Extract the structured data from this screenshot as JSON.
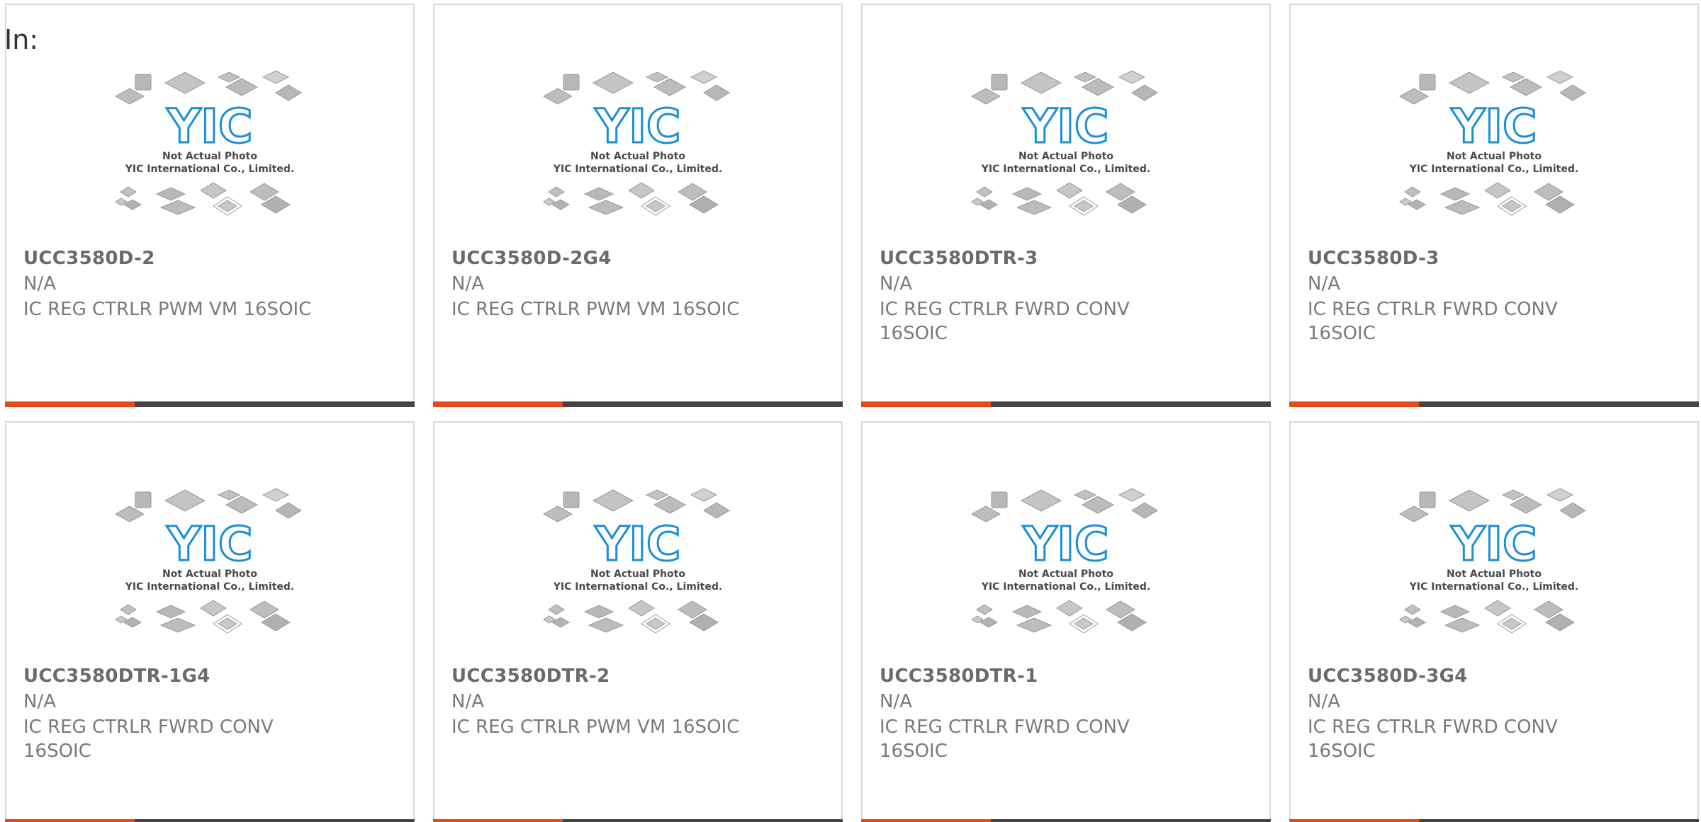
{
  "header": {
    "label": "In:"
  },
  "colors": {
    "accent": "#e64a19",
    "bar": "#444444",
    "logo": "#1b8ed6",
    "text": "#7a7a7a"
  },
  "placeholder": {
    "line1": "Not Actual Photo",
    "line2": "YIC International Co., Limited.",
    "logo_text": "YIC"
  },
  "products": [
    {
      "part": "UCC3580D-2",
      "mfr": "N/A",
      "desc": "IC REG CTRLR PWM VM 16SOIC"
    },
    {
      "part": "UCC3580D-2G4",
      "mfr": "N/A",
      "desc": "IC REG CTRLR PWM VM 16SOIC"
    },
    {
      "part": "UCC3580DTR-3",
      "mfr": "N/A",
      "desc": "IC REG CTRLR FWRD CONV 16SOIC"
    },
    {
      "part": "UCC3580D-3",
      "mfr": "N/A",
      "desc": "IC REG CTRLR FWRD CONV 16SOIC"
    },
    {
      "part": "UCC3580DTR-1G4",
      "mfr": "N/A",
      "desc": "IC REG CTRLR FWRD CONV 16SOIC"
    },
    {
      "part": "UCC3580DTR-2",
      "mfr": "N/A",
      "desc": "IC REG CTRLR PWM VM 16SOIC"
    },
    {
      "part": "UCC3580DTR-1",
      "mfr": "N/A",
      "desc": "IC REG CTRLR FWRD CONV 16SOIC"
    },
    {
      "part": "UCC3580D-3G4",
      "mfr": "N/A",
      "desc": "IC REG CTRLR FWRD CONV 16SOIC"
    }
  ]
}
